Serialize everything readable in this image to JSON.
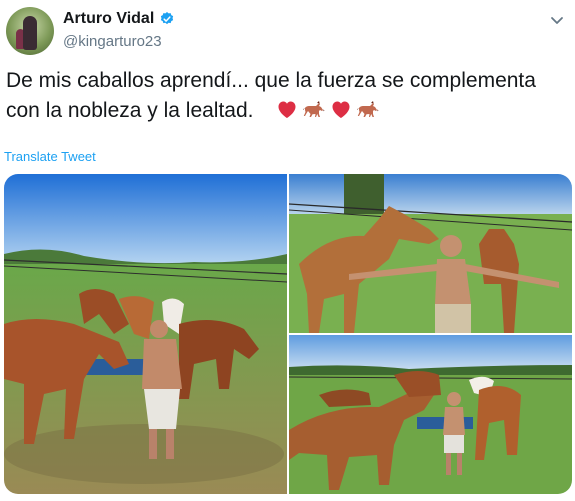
{
  "author": {
    "name": "Arturo Vidal",
    "handle": "@kingarturo23"
  },
  "tweet": {
    "text": "De mis caballos aprendí... que la fuerza se complementa con la nobleza y la lealtad.",
    "emojis": [
      "red-heart",
      "horse",
      "red-heart",
      "horse"
    ]
  },
  "translate_label": "Translate Tweet",
  "colors": {
    "link": "#1da1f2",
    "verified": "#1da1f2",
    "secondary_text": "#657786"
  },
  "media": {
    "photos": [
      "horses-eating-from-feeder",
      "man-with-horses-arms-outstretched",
      "man-standing-with-horses-in-field"
    ]
  }
}
